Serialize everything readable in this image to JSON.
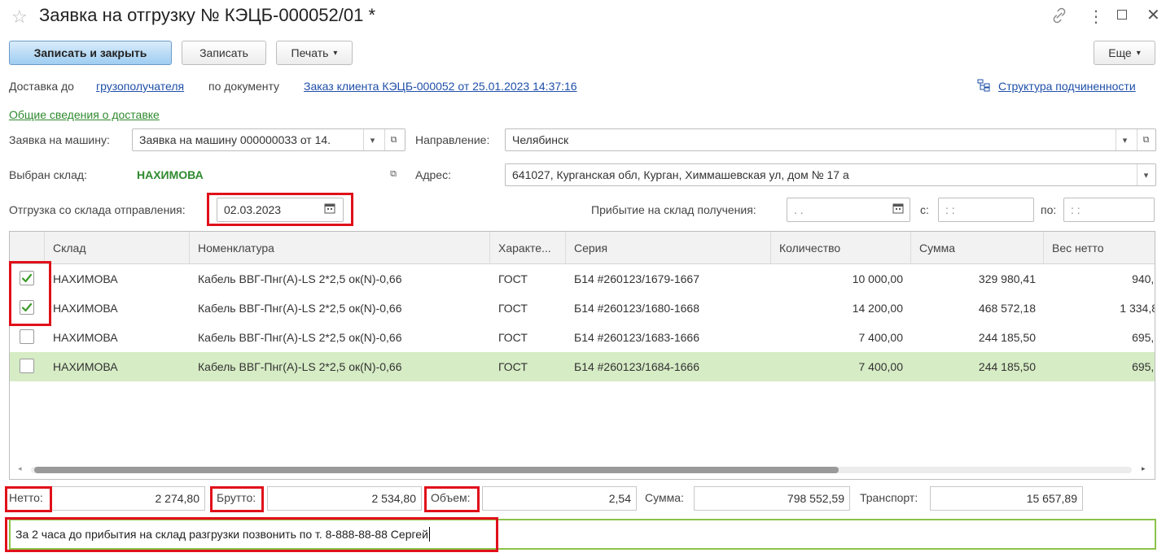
{
  "window": {
    "title": "Заявка на отгрузку № КЭЦБ-000052/01 *"
  },
  "toolbar": {
    "save_close": "Записать и закрыть",
    "save": "Записать",
    "print": "Печать",
    "more": "Еще"
  },
  "delivery": {
    "prefix": "Доставка до",
    "recipient_link": "грузополучателя",
    "by_doc": "по документу",
    "doc_link": "Заказ клиента КЭЦБ-000052 от 25.01.2023 14:37:16",
    "structure_link": "Структура подчиненности",
    "general_link": "Общие сведения о доставке"
  },
  "form": {
    "car_request_label": "Заявка на машину:",
    "car_request_value": "Заявка на машину 000000033 от 14.",
    "direction_label": "Направление:",
    "direction_value": "Челябинск",
    "warehouse_label": "Выбран склад:",
    "warehouse_value": "НАХИМОВА",
    "address_label": "Адрес:",
    "address_value": "641027, Курганская обл, Курган, Химмашевская ул, дом № 17 а",
    "ship_label": "Отгрузка со склада отправления:",
    "ship_date": "02.03.2023",
    "arrival_label": "Прибытие на склад получения:",
    "arrival_date": " .  .",
    "from_label": "с:",
    "from_value": " :  :",
    "to_label": "по:",
    "to_value": " :  :"
  },
  "table": {
    "headers": [
      "Склад",
      "Номенклатура",
      "Характе...",
      "Серия",
      "Количество",
      "Сумма",
      "Вес нетто"
    ],
    "rows": [
      {
        "checked": true,
        "cells": [
          "НАХИМОВА",
          "Кабель ВВГ-Пнг(А)-LS 2*2,5 ок(N)-0,66",
          "ГОСТ",
          "Б14 #260123/1679-1667",
          "10 000,00",
          "329 980,41",
          "940,("
        ]
      },
      {
        "checked": true,
        "cells": [
          "НАХИМОВА",
          "Кабель ВВГ-Пнг(А)-LS 2*2,5 ок(N)-0,66",
          "ГОСТ",
          "Б14 #260123/1680-1668",
          "14 200,00",
          "468 572,18",
          "1 334,8"
        ]
      },
      {
        "checked": false,
        "cells": [
          "НАХИМОВА",
          "Кабель ВВГ-Пнг(А)-LS 2*2,5 ок(N)-0,66",
          "ГОСТ",
          "Б14 #260123/1683-1666",
          "7 400,00",
          "244 185,50",
          "695,("
        ]
      },
      {
        "checked": false,
        "selected": true,
        "cells": [
          "НАХИМОВА",
          "Кабель ВВГ-Пнг(А)-LS 2*2,5 ок(N)-0,66",
          "ГОСТ",
          "Б14 #260123/1684-1666",
          "7 400,00",
          "244 185,50",
          "695,("
        ]
      }
    ]
  },
  "totals": {
    "netto_label": "Нетто:",
    "netto_value": "2 274,80",
    "brutto_label": "Брутто:",
    "brutto_value": "2 534,80",
    "volume_label": "Объем:",
    "volume_value": "2,54",
    "sum_label": "Сумма:",
    "sum_value": "798 552,59",
    "transport_label": "Транспорт:",
    "transport_value": "15 657,89"
  },
  "comment": {
    "value": "За 2 часа до прибытия на склад разгрузки позвонить по т. 8-888-88-88 Сергей"
  },
  "colors": {
    "accent_link": "#1f4fa8",
    "selected_row": "#d6ecc5",
    "highlight_box": "#e0101a",
    "checkmark": "#3a9a2a"
  }
}
